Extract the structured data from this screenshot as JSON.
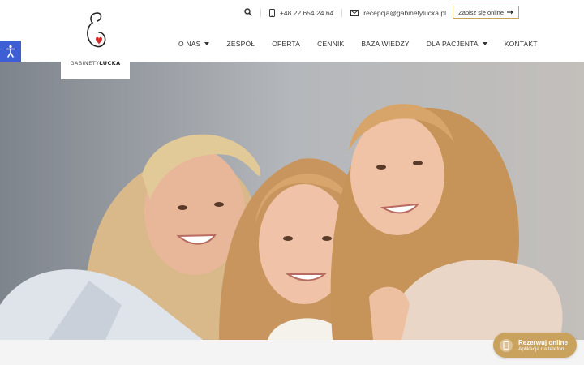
{
  "logo": {
    "text_light": "GABINETY",
    "text_bold": "ŁUCKA"
  },
  "contact": {
    "phone": "+48 22 654 24 64",
    "email": "recepcja@gabinetylucka.pl",
    "signup_label": "Zapisz się online"
  },
  "nav": {
    "items": [
      {
        "label": "O NAS",
        "dropdown": true
      },
      {
        "label": "ZESPÓŁ",
        "dropdown": false
      },
      {
        "label": "OFERTA",
        "dropdown": false
      },
      {
        "label": "CENNIK",
        "dropdown": false
      },
      {
        "label": "BAZA WIEDZY",
        "dropdown": false
      },
      {
        "label": "DLA PACJENTA",
        "dropdown": true
      },
      {
        "label": "KONTAKT",
        "dropdown": false
      }
    ]
  },
  "booking": {
    "title": "Rezerwuj online",
    "subtitle": "Aplikacja na telefon"
  },
  "colors": {
    "accent": "#c9a25e",
    "accessibility": "#3e5ed4"
  },
  "icons": [
    "search-icon",
    "phone-icon",
    "mail-icon",
    "arrow-right-icon",
    "accessibility-icon",
    "calendar-phone-icon"
  ]
}
